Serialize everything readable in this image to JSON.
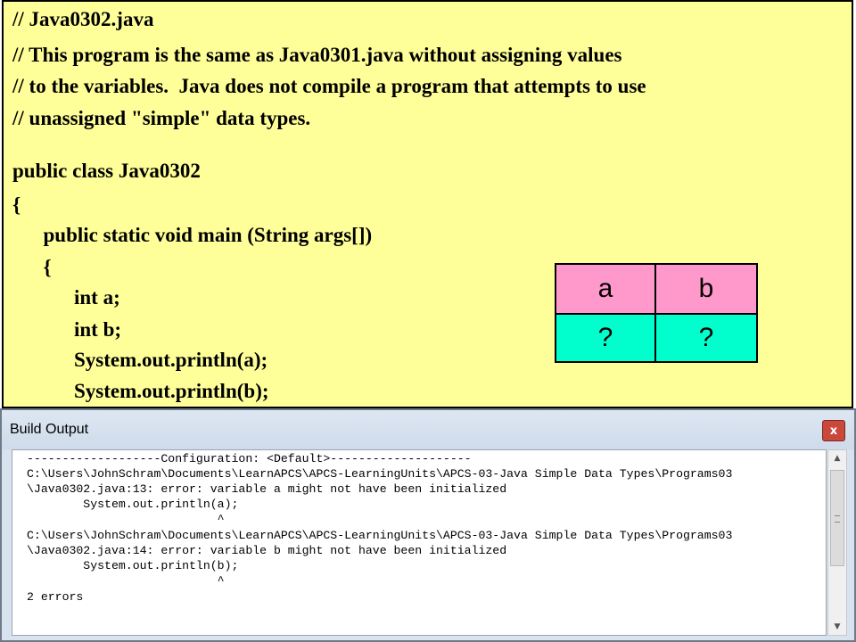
{
  "code": {
    "lines": [
      "// Java0302.java",
      "// This program is the same as Java0301.java without assigning values",
      "// to the variables.  Java does not compile a program that attempts to use",
      "// unassigned \"simple\" data types.",
      "public class Java0302",
      "{",
      "      public static void main (String args[])",
      "      {",
      "            int a;",
      "            int b;",
      "            System.out.println(a);",
      "            System.out.println(b);"
    ]
  },
  "variables": {
    "headers": [
      "a",
      "b"
    ],
    "values": [
      "?",
      "?"
    ],
    "colors": {
      "header_bg": "#ff99cc",
      "value_bg": "#00ffcc"
    }
  },
  "build_output": {
    "title": "Build Output",
    "close_label": "x",
    "lines": [
      "-------------------Configuration: <Default>--------------------",
      "C:\\Users\\JohnSchram\\Documents\\LearnAPCS\\APCS-LearningUnits\\APCS-03-Java Simple Data Types\\Programs03",
      "\\Java0302.java:13: error: variable a might not have been initialized",
      "        System.out.println(a);",
      "                           ^",
      "C:\\Users\\JohnSchram\\Documents\\LearnAPCS\\APCS-LearningUnits\\APCS-03-Java Simple Data Types\\Programs03",
      "\\Java0302.java:14: error: variable b might not have been initialized",
      "        System.out.println(b);",
      "                           ^",
      "2 errors"
    ]
  },
  "colors": {
    "code_bg": "#ffff99",
    "window_bg": "#d9e3f0",
    "close_red": "#c9473b"
  }
}
